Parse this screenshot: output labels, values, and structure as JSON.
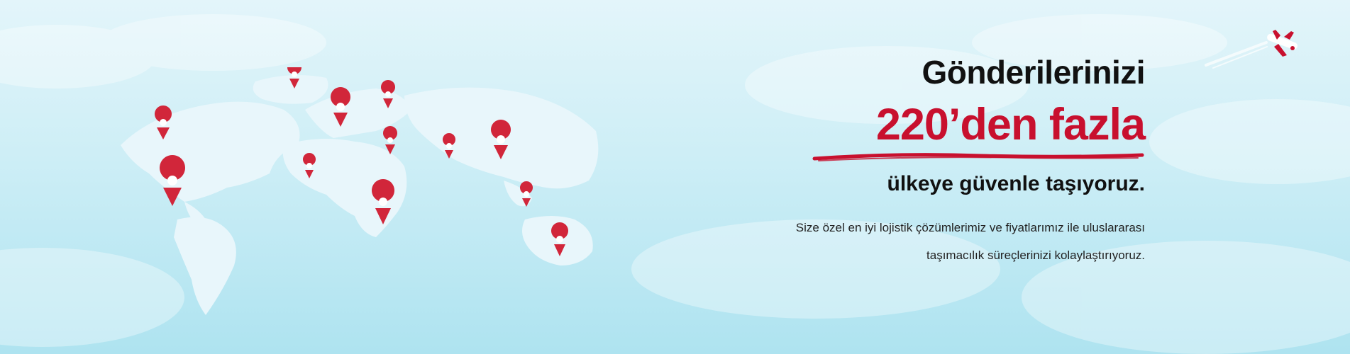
{
  "hero": {
    "line1": "Gönderilerinizi",
    "line2": "220’den fazla",
    "line3": "ülkeye güvenle taşıyoruz.",
    "paragraph_line1": "Size özel en iyi lojistik çözümlerimiz ve fiyatlarımız ile uluslararası",
    "paragraph_line2": "taşımacılık süreçlerinizi kolaylaştırıyoruz."
  },
  "colors": {
    "accent": "#c8102e",
    "text": "#111111",
    "map_land": "#e8f6fb",
    "sky_top": "#e3f5fa",
    "sky_bottom": "#aee3f0"
  },
  "icons": [
    "location-pin-icon",
    "airplane-icon",
    "world-map"
  ]
}
